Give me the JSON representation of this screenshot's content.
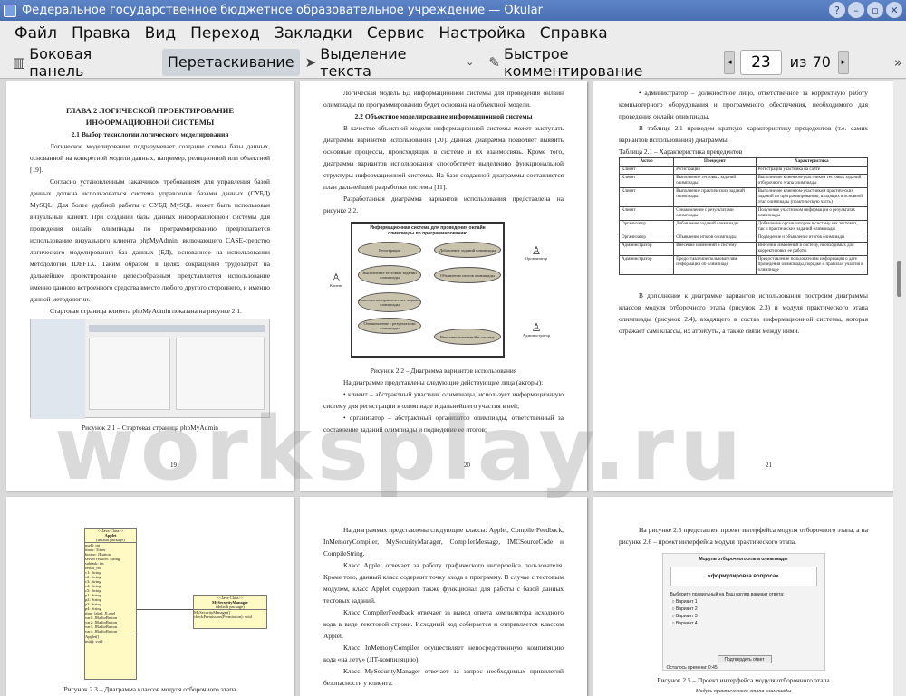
{
  "window": {
    "title": "Федеральное государственное бюджетное образовательное учреждение  — Okular"
  },
  "menu": [
    "Файл",
    "Правка",
    "Вид",
    "Переход",
    "Закладки",
    "Сервис",
    "Настройка",
    "Справка"
  ],
  "toolbar": {
    "sidebar": "Боковая панель",
    "drag": "Перетаскивание",
    "text_select": "Выделение текста",
    "quick_comment": "Быстрое комментирование",
    "current_page": "23",
    "of_label": "из",
    "total_pages": "70"
  },
  "watermark": "worksplay.ru",
  "pages": {
    "p19": {
      "heading1": "ГЛАВА 2 ЛОГИЧЕСКОЙ ПРОЕКТИРОВАНИЕ",
      "heading1b": "ИНФОРМАЦИОННОЙ СИСТЕМЫ",
      "heading2": "2.1 Выбор технологии логического моделирования",
      "para1": "Логическое моделирование подразумевает создание схемы базы данных, основанной на конкретной модели данных, например, реляционной или объектной [19].",
      "para2": "Согласно установленным заказчиком требованиям для управления базой данных должна использоваться система управления базами данных (СУБД) MySQL. Для более удобной работы с СУБД MySQL может быть использован визуальный клиент. При создании базы данных информационной системы для проведения онлайн олимпиады по программированию предполагается использование визуального клиента phpMyAdmin, включающего CASE-средство логического моделирования баз данных (БД), основанное на использовании методологии IDEF1X. Таким образом, в целях сокращения трудозатрат на дальнейшее проектирование целесообразным представляется использование именно данного встроенного средства вместо любого другого стороннего, и именно данной методологии.",
      "para3": "Стартовая страница клиента phpMyAdmin показана на рисунке 2.1.",
      "caption": "Рисунок 2.1 – Стартовая страница phpMyAdmin",
      "number": "19"
    },
    "p20": {
      "para1": "Логическая модель БД информационной системы для проведения онлайн олимпиады по программированию будет основана на объектной модели.",
      "heading2": "2.2 Объектное моделирование информационной системы",
      "para2": "В качестве объектной модели информационной системы может выступать диаграмма вариантов использования [20]. Данная диаграмма позволяет выявить основные процессы, происходящие в системе и их взаимосвязь. Кроме того, диаграмма вариантов использования способствует выделению функциональной структуры информационной системы. На базе созданной диаграммы составляется план дальнейшей разработки системы [11].",
      "para3": "Разработанная диаграмма вариантов использования представлена на рисунке 2.2.",
      "diagram_title": "Информационная система для проведения онлайн олимпиады по программированию",
      "use_cases": [
        "Регистрация",
        "Добавление заданий олимпиады",
        "Выполнение тестовых заданий олимпиады",
        "Объявление итогов олимпиады",
        "Выполнение практических заданий олимпиады",
        "Ознакомление с результатами олимпиады",
        "Внесение изменений в систему"
      ],
      "actor_client": "Клиент",
      "actor_organizer": "Организатор",
      "actor_admin": "Администратор",
      "caption": "Рисунок 2.2 – Диаграмма вариантов использования",
      "para4": "На диаграмме представлены следующие действующие лица (акторы):",
      "bullet1": "клиент – абстрактный участник олимпиады, использует информационную систему для регистрации в олимпиаде и дальнейшего участия в ней;",
      "bullet2": "организатор – абстрактный организатор олимпиады, ответственный за составление заданий олимпиады и подведение ее итогов;",
      "number": "20"
    },
    "p21": {
      "bullet1": "администратор – должностное лицо, ответственное за корректную работу компьютерного оборудования и программного обеспечения, необходимого для проведения онлайн олимпиады.",
      "para1": "В таблице 2.1 приведем краткую характеристику прецедентов (т.е. самих вариантов использования) диаграммы.",
      "table_caption": "Таблица 2.1 – Характеристика прецедентов",
      "table_headers": [
        "Актор",
        "Прецедент",
        "Характеристика"
      ],
      "table_rows": [
        [
          "Клиент",
          "Регистрация",
          "Регистрация участника на сайте"
        ],
        [
          "Клиент",
          "Выполнение тестовых заданий олимпиады",
          "Выполнение клиентом-участником тестовых заданий отборочного этапа олимпиады"
        ],
        [
          "Клиент",
          "Выполнение практических заданий олимпиады",
          "Выполнение клиентом-участником практических заданий по программированию, входящих в основной этап олимпиады (практическую часть)"
        ],
        [
          "Клиент",
          "Ознакомление с результатами олимпиады",
          "Получение участником информации о результатах олимпиады"
        ],
        [
          "Организатор",
          "Добавление заданий олимпиады",
          "Добавление организатором в систему как тестовых, так и практических заданий олимпиады"
        ],
        [
          "Организатор",
          "Объявление итогов олимпиады",
          "Подведение и объявление итогов олимпиады"
        ],
        [
          "Администратор",
          "Внесение изменений в систему",
          "Внесение изменений в систему, необходимых для корректировки ее работы"
        ],
        [
          "Администратор",
          "Предоставление пользователям информации об олимпиаде",
          "Предоставление пользователям информации о дате проведения олимпиады, порядке и правилах участия в олимпиаде"
        ]
      ],
      "para2": "В дополнение к диаграмме вариантов использования построим диаграммы классов модуля отборочного этапа (рисунок 2.3) и модуля практического этапа олимпиады (рисунок 2.4), входящего в состав информационной системы, которая отражает самі классы, их атрибуты, а также связи между ними.",
      "number": "21"
    },
    "p22": {
      "class1_stereo": "<<Java Class>>",
      "class1_name": "Applet",
      "class1_pkg": "(default package)",
      "class1_fields": [
        "useR: int",
        "timer: Timer",
        "button: JButton",
        "serverVersion: String",
        "subtask: int",
        "result_cnt",
        "c1: String",
        "c2: String",
        "c3: String",
        "c4: String",
        "c5: String",
        "p1: String",
        "p2: String",
        "p3: String",
        "p4: String",
        "time_label: JLabel",
        "var1: JRadioButton",
        "var2: JRadioButton",
        "var3: JRadioButton",
        "var4: JRadioButton"
      ],
      "class1_methods": [
        "Applet()",
        "init(): void"
      ],
      "class2_stereo": "<<Java Class>>",
      "class2_name": "MySecurityManager",
      "class2_pkg": "(default package)",
      "class2_methods": [
        "MySecurityManager()",
        "checkPermission(Permission): void"
      ],
      "caption": "Рисунок 2.3 – Диаграмма классов модуля отборочного этапа"
    },
    "p23": {
      "para1": "На диаграммах представлены следующие классы: Applet, CompilerFeedback, InMemoryCompiler, MySecurityManager, CompilerMessage, IMCSourceCode и CompileString.",
      "para2": "Класс Applet отвечает за работу графического интерфейса пользователя. Кроме того, данный класс содержит точку входа в программу. В случае с тестовым модулем, класс Applet содержит также функционал для работы с базой данных тестовых заданий.",
      "para3": "Класс CompilerFeedback отвечает за вывод ответа компилятора исходного кода в виде текстовой строки. Исходный код собирается и отправляется классом Applet.",
      "para4": "Класс InMemoryCompiler осуществляет непосредственную компиляцию кода «на лету» (JIT-компиляцию).",
      "para5": "Класс MySecurityManager отвечает за запрос необходимых привилегий безопасности у клиента."
    },
    "p24": {
      "para1": "На рисунке 2.5 представлен проект интерфейса модуля отборочного этапа, а на рисунке 2.6 – проект интерфейса модуля практического этапа.",
      "form_title": "Модуль отборочного этапа олимпиады",
      "form_question": "«формулировка вопроса»",
      "form_prompt": "Выберите правильный на Ваш взгляд вариант ответа:",
      "form_options": [
        "Вариант 1",
        "Вариант 2",
        "Вариант 3",
        "Вариант 4"
      ],
      "form_submit": "Подтвердить ответ",
      "form_timer": "Осталось времени: 0:45",
      "caption": "Рисунок 2.5 – Проект интерфейса модуля отборочного этапа",
      "next_title": "Модуль практического этапа олимпиады"
    }
  }
}
